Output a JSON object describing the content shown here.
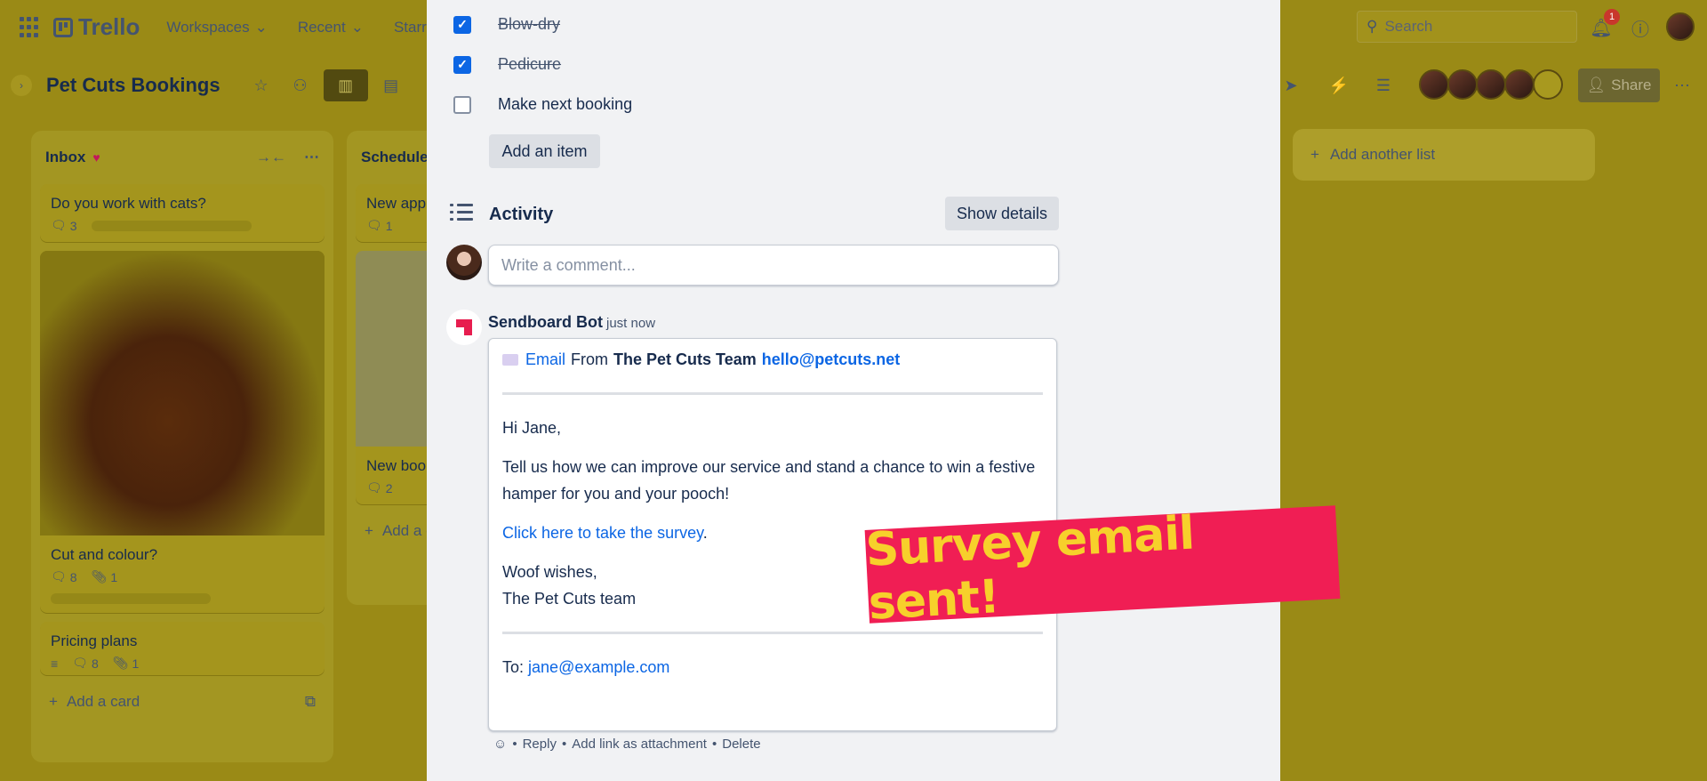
{
  "topbar": {
    "app_name": "Trello",
    "nav": [
      {
        "label": "Workspaces"
      },
      {
        "label": "Recent"
      },
      {
        "label": "Starred"
      }
    ],
    "search_placeholder": "Search",
    "notification_count": "1"
  },
  "board": {
    "title": "Pet Cuts Bookings",
    "share_label": "Share",
    "add_list_label": "Add another list"
  },
  "lists": [
    {
      "name": "Inbox",
      "add_card_label": "Add a card",
      "cards": [
        {
          "title": "Do you work with cats?",
          "comments": "3"
        },
        {
          "title": "Cut and colour?",
          "comments": "8",
          "attachments": "1"
        },
        {
          "title": "Pricing plans",
          "comments": "8",
          "attachments": "1"
        }
      ]
    },
    {
      "name": "Schedule",
      "add_card_label": "Add a card",
      "cards": [
        {
          "title": "New app",
          "comments": "1"
        },
        {
          "title": "New boo",
          "comments": "2"
        }
      ]
    }
  ],
  "checklist": [
    {
      "label": "Blow-dry",
      "checked": true
    },
    {
      "label": "Pedicure",
      "checked": true
    },
    {
      "label": "Make next booking",
      "checked": false
    }
  ],
  "add_item_label": "Add an item",
  "activity": {
    "title": "Activity",
    "show_details_label": "Show details",
    "comment_placeholder": "Write a comment..."
  },
  "message": {
    "author": "Sendboard Bot",
    "time": "just now",
    "email_label": "Email",
    "from_label": "From",
    "sender_name": "The Pet Cuts Team",
    "sender_email": "hello@petcuts.net",
    "greeting": "Hi Jane,",
    "body": "Tell us how we can improve our service and stand a chance to win a festive hamper for you and your pooch!",
    "survey_link": "Click here to take the survey",
    "survey_link_suffix": ".",
    "signoff_line1": "Woof wishes,",
    "signoff_line2": "The Pet Cuts team",
    "to_label": "To:",
    "to_email": "jane@example.com",
    "actions": {
      "reply": "Reply",
      "add_link": "Add link as attachment",
      "delete": "Delete",
      "separator": "•"
    }
  },
  "banner_text": "Survey email sent!",
  "colors": {
    "accent": "#0c66e4",
    "banner_bg": "#f01e54",
    "banner_text": "#f7d02b",
    "board_bg": "#9a8a16"
  }
}
